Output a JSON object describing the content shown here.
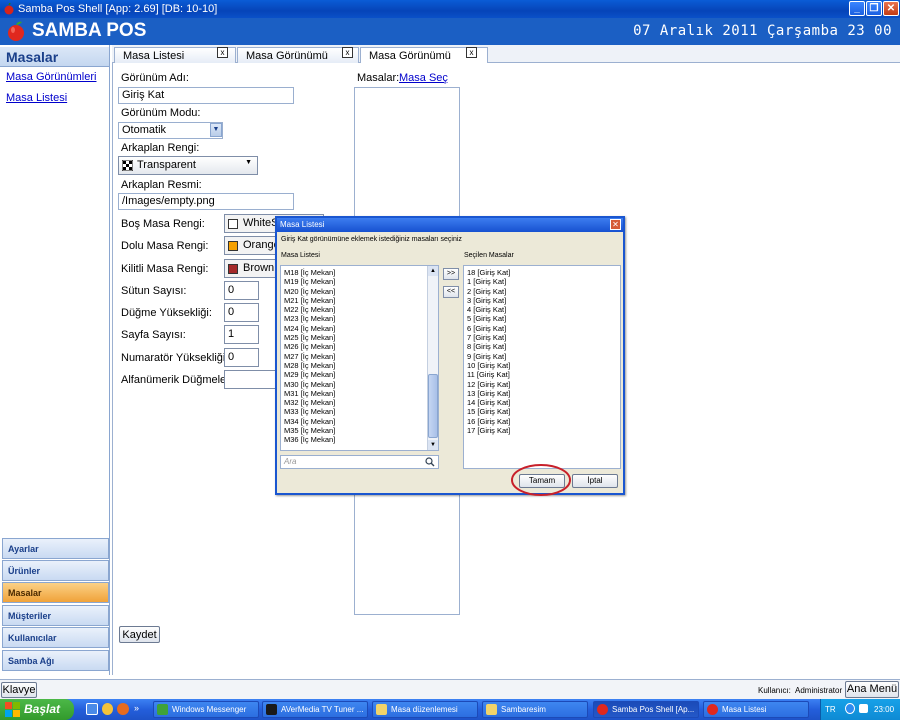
{
  "window": {
    "title": "Samba Pos Shell [App: 2.69] [DB: 10-10]",
    "app_name": "SAMBA POS",
    "datetime": "07 Aralık 2011 Çarşamba 23 00"
  },
  "sidebar": {
    "header": "Masalar",
    "links": [
      "Masa Görünümleri",
      "Masa Listesi"
    ],
    "nav": [
      {
        "label": "Ayarlar"
      },
      {
        "label": "Ürünler"
      },
      {
        "label": "Masalar"
      },
      {
        "label": "Müşteriler"
      },
      {
        "label": "Kullanıcılar"
      },
      {
        "label": "Samba Ağı"
      }
    ]
  },
  "tabs": [
    {
      "label": "Masa Listesi"
    },
    {
      "label": "Masa Görünümü Liste"
    },
    {
      "label": "Masa Görünümü (Giriş"
    }
  ],
  "form": {
    "view_name_label": "Görünüm Adı:",
    "view_name_value": "Giriş Kat",
    "view_mode_label": "Görünüm Modu:",
    "view_mode_value": "Otomatik",
    "bg_color_label": "Arkaplan Rengi:",
    "bg_color_value": "Transparent",
    "bg_image_label": "Arkaplan Resmi:",
    "bg_image_value": "/Images/empty.png",
    "empty_color_label": "Boş Masa Rengi:",
    "empty_color_value": "WhiteS",
    "full_color_label": "Dolu Masa Rengi:",
    "full_color_value": "Orange",
    "locked_color_label": "Kilitli Masa Rengi:",
    "locked_color_value": "Brown",
    "columns_label": "Sütun Sayısı:",
    "columns_value": "0",
    "button_height_label": "Düğme Yüksekliği:",
    "button_height_value": "0",
    "page_count_label": "Sayfa Sayısı:",
    "page_count_value": "1",
    "numerator_height_label": "Numaratör Yüksekliği:",
    "numerator_height_value": "0",
    "alnum_buttons_label": "Alfanümerik Düğmeler:",
    "tables_label": "Masalar:",
    "select_tables_link": "Masa Seç",
    "save_label": "Kaydet"
  },
  "dialog": {
    "title": "Masa Listesi",
    "instruction": "Giriş Kat görünümüne eklemek istediğiniz masaları seçiniz",
    "left_header": "Masa Listesi",
    "right_header": "Seçilen Masalar",
    "add_label": ">>",
    "remove_label": "<<",
    "search_placeholder": "Ara",
    "ok_label": "Tamam",
    "cancel_label": "İptal",
    "available": [
      "M18 [İç Mekan]",
      "M19 [İç Mekan]",
      "M20 [İç Mekan]",
      "M21 [İç Mekan]",
      "M22 [İç Mekan]",
      "M23 [İç Mekan]",
      "M24 [İç Mekan]",
      "M25 [İç Mekan]",
      "M26 [İç Mekan]",
      "M27 [İç Mekan]",
      "M28 [İç Mekan]",
      "M29 [İç Mekan]",
      "M30 [İç Mekan]",
      "M31 [İç Mekan]",
      "M32 [İç Mekan]",
      "M33 [İç Mekan]",
      "M34 [İç Mekan]",
      "M35 [İç Mekan]",
      "M36 [İç Mekan]"
    ],
    "selected": [
      "18 [Giriş Kat]",
      "1 [Giriş Kat]",
      "2 [Giriş Kat]",
      "3 [Giriş Kat]",
      "4 [Giriş Kat]",
      "5 [Giriş Kat]",
      "6 [Giriş Kat]",
      "7 [Giriş Kat]",
      "8 [Giriş Kat]",
      "9 [Giriş Kat]",
      "10 [Giriş Kat]",
      "11 [Giriş Kat]",
      "12 [Giriş Kat]",
      "13 [Giriş Kat]",
      "14 [Giriş Kat]",
      "15 [Giriş Kat]",
      "16 [Giriş Kat]",
      "17 [Giriş Kat]"
    ]
  },
  "bottom": {
    "keyboard_label": "Klavye",
    "user_label": "Kullanıcı:",
    "user_value": "Administrator",
    "main_menu_label": "Ana Menü"
  },
  "taskbar": {
    "start_label": "Başlat",
    "items": [
      {
        "label": "Windows Messenger"
      },
      {
        "label": "AVerMedia TV Tuner ..."
      },
      {
        "label": "Masa düzenlemesi"
      },
      {
        "label": "Sambaresim"
      },
      {
        "label": "Samba Pos Shell [Ap..."
      },
      {
        "label": "Masa Listesi"
      }
    ],
    "lang": "TR",
    "clock": "23:00"
  }
}
